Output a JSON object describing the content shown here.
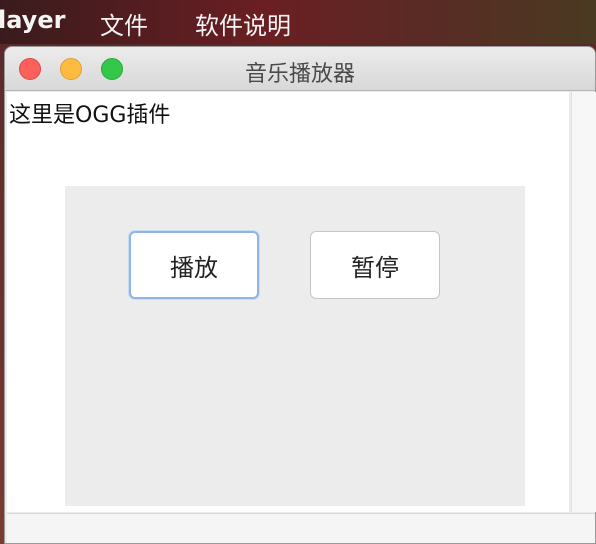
{
  "menubar": {
    "app_name": "layer",
    "items": [
      "文件",
      "软件说明"
    ]
  },
  "window": {
    "title": "音乐播放器",
    "plugin_label": "这里是OGG插件",
    "buttons": {
      "play": "播放",
      "pause": "暂停"
    }
  },
  "colors": {
    "close": "#fc605b",
    "minimize": "#fdbc40",
    "maximize": "#34c84a",
    "focus_ring": "#8fb4e8"
  }
}
